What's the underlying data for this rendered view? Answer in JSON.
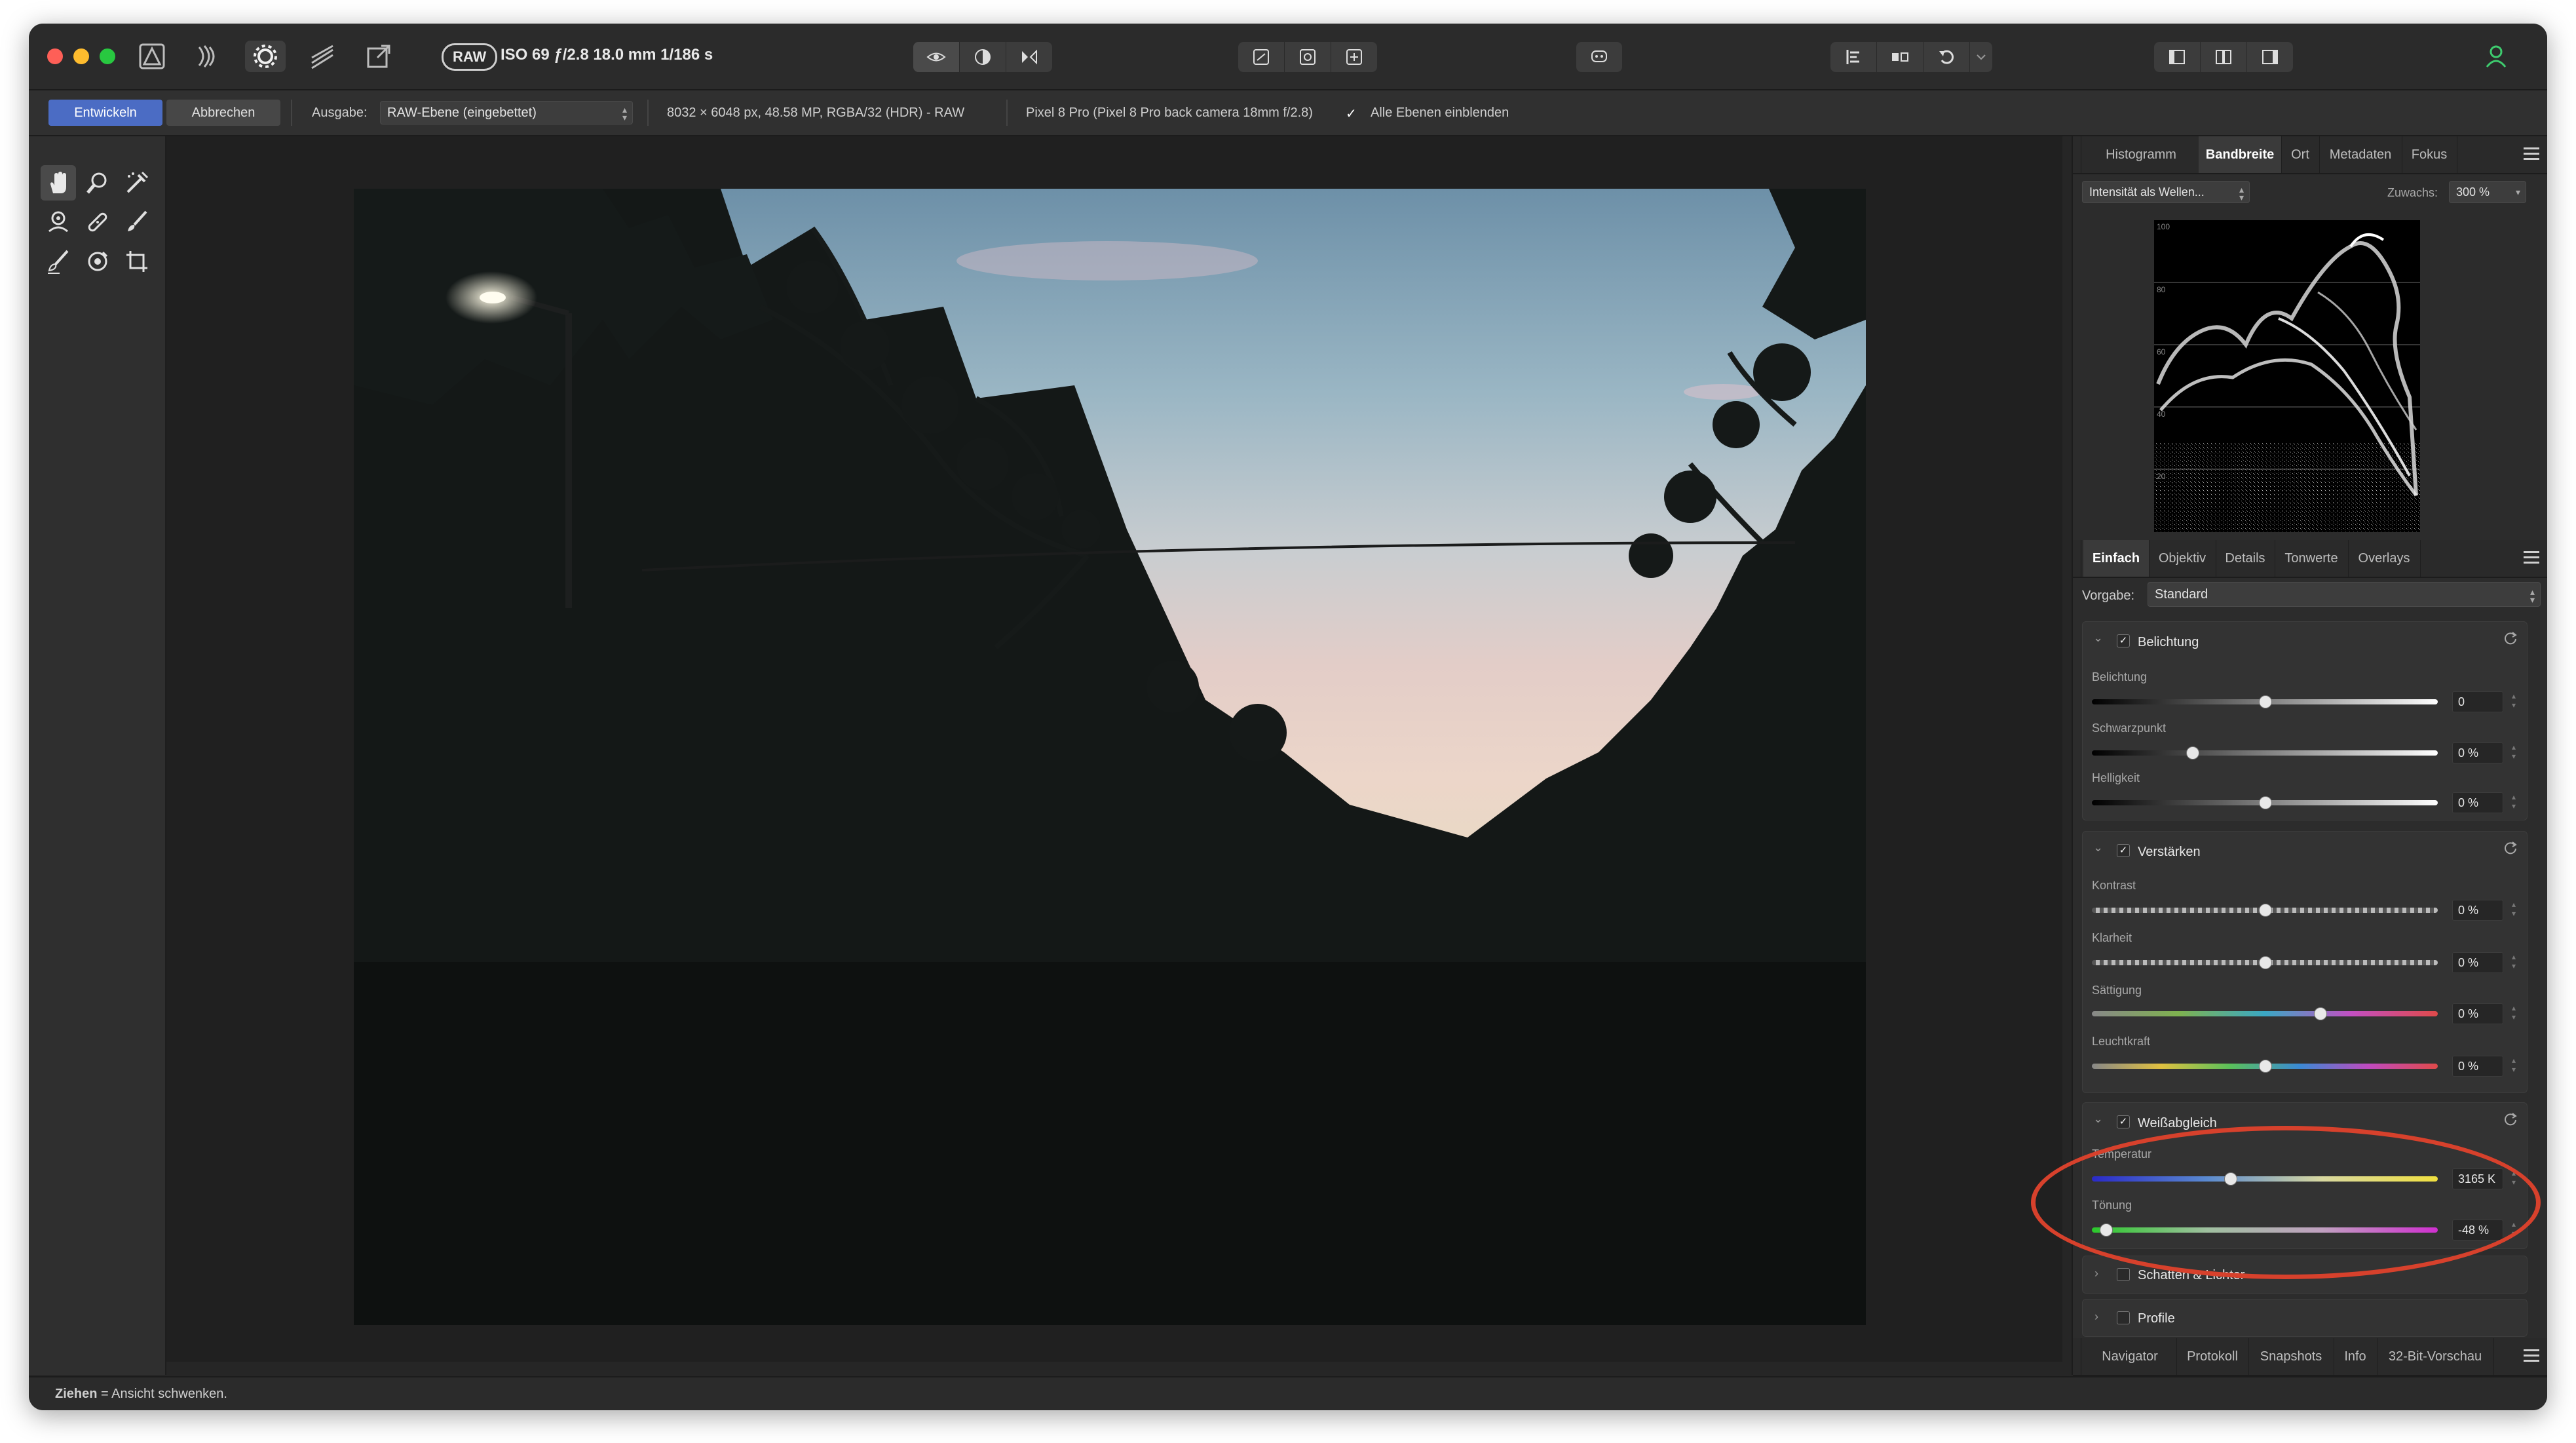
{
  "toolbar": {
    "raw_badge": "RAW",
    "camera_info": "ISO 69 ƒ/2.8 18.0 mm 1/186 s"
  },
  "context": {
    "develop_label": "Entwickeln",
    "cancel_label": "Abbrechen",
    "output_label": "Ausgabe:",
    "output_value": "RAW-Ebene (eingebettet)",
    "image_info": "8032 × 6048 px, 48.58 MP, RGBA/32 (HDR) - RAW",
    "camera_model": "Pixel 8 Pro (Pixel 8 Pro back camera 18mm f/2.8)",
    "show_layers_label": "Alle Ebenen einblenden"
  },
  "scope_panel": {
    "tabs": [
      "Histogramm",
      "Bandbreite",
      "Ort",
      "Metadaten",
      "Fokus"
    ],
    "active_tab": "Bandbreite",
    "mode_value": "Intensität als Wellen...",
    "zoom_label": "Zuwachs:",
    "zoom_value": "300 %",
    "scale_labels": [
      "100",
      "80",
      "60",
      "40",
      "20"
    ]
  },
  "adjust_panel": {
    "tabs": [
      "Einfach",
      "Objektiv",
      "Details",
      "Tonwerte",
      "Overlays"
    ],
    "active_tab": "Einfach",
    "preset_label": "Vorgabe:",
    "preset_value": "Standard",
    "exposure": {
      "title": "Belichtung",
      "sliders": [
        {
          "label": "Belichtung",
          "value": "0",
          "pos": 0.5
        },
        {
          "label": "Schwarzpunkt",
          "value": "0 %",
          "pos": 0.29
        },
        {
          "label": "Helligkeit",
          "value": "0 %",
          "pos": 0.5
        }
      ]
    },
    "enhance": {
      "title": "Verstärken",
      "sliders": [
        {
          "label": "Kontrast",
          "value": "0 %",
          "pos": 0.5
        },
        {
          "label": "Klarheit",
          "value": "0 %",
          "pos": 0.5
        },
        {
          "label": "Sättigung",
          "value": "0 %",
          "pos": 0.66
        },
        {
          "label": "Leuchtkraft",
          "value": "0 %",
          "pos": 0.5
        }
      ]
    },
    "white_balance": {
      "title": "Weißabgleich",
      "sliders": [
        {
          "label": "Temperatur",
          "value": "3165 K",
          "pos": 0.4
        },
        {
          "label": "Tönung",
          "value": "-48 %",
          "pos": 0.04
        }
      ]
    },
    "collapsed_groups": [
      "Schatten & Lichter",
      "Profile"
    ]
  },
  "bottom_tabs": [
    "Navigator",
    "Protokoll",
    "Snapshots",
    "Info",
    "32-Bit-Vorschau"
  ],
  "status": {
    "action": "Ziehen",
    "hint": " = Ansicht schwenken."
  },
  "colors": {
    "accent": "#4b6cc4",
    "annotation": "#d7412c"
  }
}
